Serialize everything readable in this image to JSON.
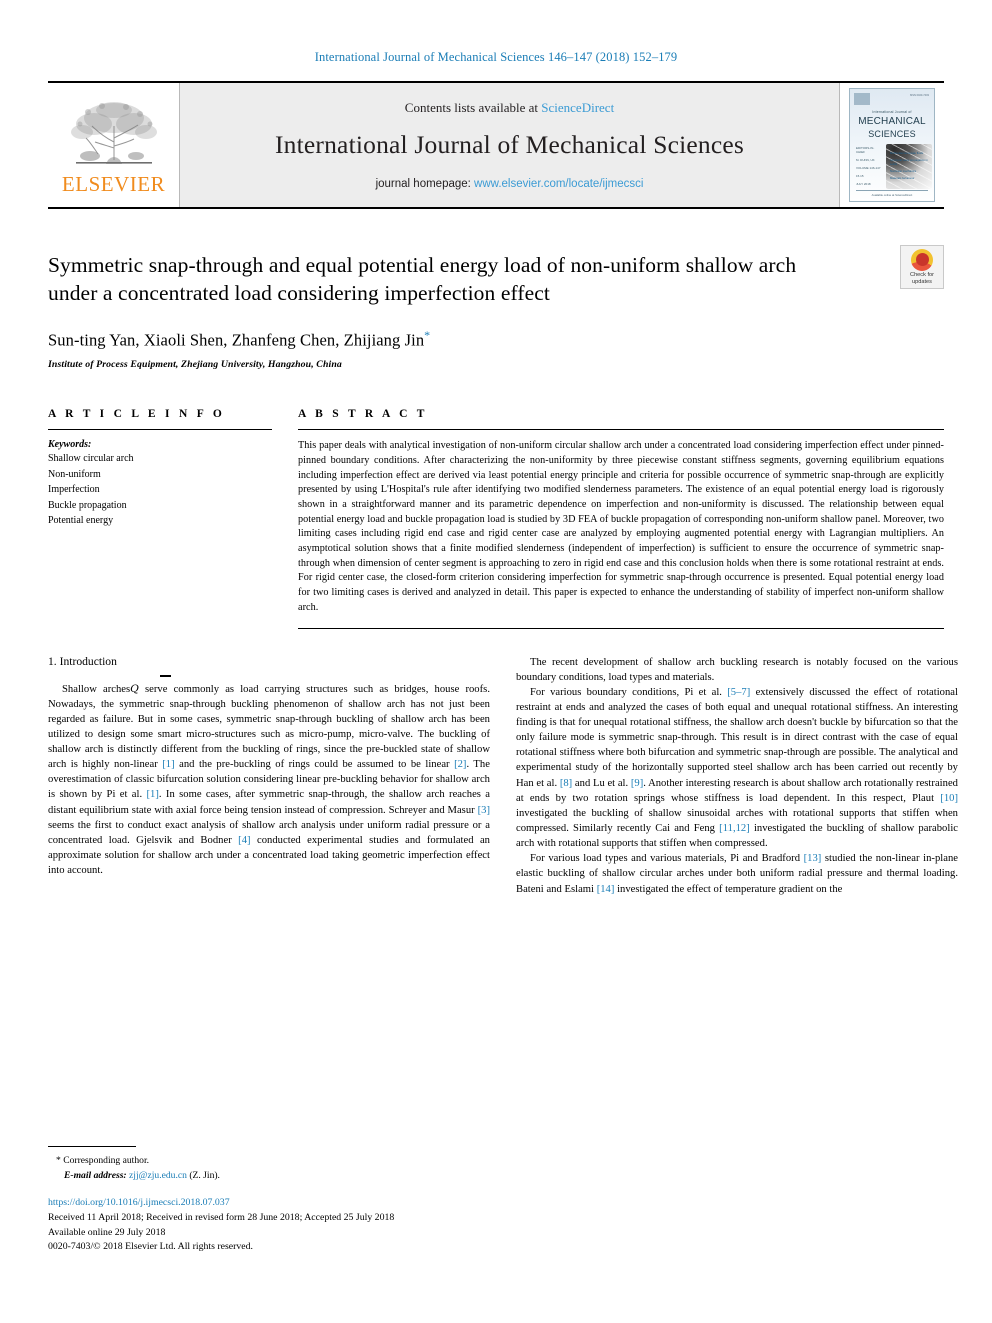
{
  "running_head": "International Journal of Mechanical Sciences 146–147 (2018) 152–179",
  "masthead": {
    "publisher": "ELSEVIER",
    "contents_prefix": "Contents lists available at ",
    "contents_link": "ScienceDirect",
    "journal_title": "International Journal of Mechanical Sciences",
    "homepage_prefix": "journal homepage: ",
    "homepage_url": "www.elsevier.com/locate/ijmecsci",
    "cover": {
      "issn": "ISSN 0020-7403",
      "subtitle": "International Journal of",
      "line1": "MECHANICAL",
      "line2": "SCIENCES",
      "left_items": [
        "EDITORS-IN-CHIEF",
        "M. DUNN, UK",
        "J.R. BARBER",
        "VOLUME 146-147",
        "ISSUE",
        "15.15",
        "JULY 2018"
      ],
      "right_items": [
        "Multiscale/nanoscale fluids",
        "Structural wave propagation in solids",
        "Nonlinear mechanics",
        "Materials behaviour"
      ],
      "footer": "Available online at ScienceDirect"
    }
  },
  "article": {
    "title": "Symmetric snap-through and equal potential energy load of non-uniform shallow arch under a concentrated load considering imperfection effect",
    "authors": "Sun-ting Yan, Xiaoli Shen, Zhanfeng Chen, Zhijiang Jin",
    "corresponding_marker": "*",
    "affiliation": "Institute of Process Equipment, Zhejiang University, Hangzhou, China",
    "crossmark": "Check for updates"
  },
  "article_info": {
    "heading": "A R T I C L E   I N F O",
    "keywords_label": "Keywords:",
    "keywords": [
      "Shallow circular arch",
      "Non-uniform",
      "Imperfection",
      "Buckle propagation",
      "Potential energy"
    ]
  },
  "abstract": {
    "heading": "A B S T R A C T",
    "text": "This paper deals with analytical investigation of non-uniform circular shallow arch under a concentrated load considering imperfection effect under pinned-pinned boundary conditions. After characterizing the non-uniformity by three piecewise constant stiffness segments, governing equilibrium equations including imperfection effect are derived via least potential energy principle and criteria for possible occurrence of symmetric snap-through are explicitly presented by using L'Hospital's rule after identifying two modified slenderness parameters. The existence of an equal potential energy load is rigorously shown in a straightforward manner and its parametric dependence on imperfection and non-uniformity is discussed. The relationship between equal potential energy load and buckle propagation load is studied by 3D FEA of buckle propagation of corresponding non-uniform shallow panel. Moreover, two limiting cases including rigid end case and rigid center case are analyzed by employing augmented potential energy with Lagrangian multipliers. An asymptotical solution shows that a finite modified slenderness (independent of imperfection) is sufficient to ensure the occurrence of symmetric snap-through when dimension of center segment is approaching to zero in rigid end case and this conclusion holds when there is some rotational restraint at ends. For rigid center case, the closed-form criterion considering imperfection for symmetric snap-through occurrence is presented. Equal potential energy load for two limiting cases is derived and analyzed in detail. This paper is expected to enhance the understanding of stability of imperfect non-uniform shallow arch."
  },
  "body": {
    "section_heading": "1. Introduction",
    "left_paragraphs": [
      "Shallow arches𝑄 serve commonly as load carrying structures such as bridges, house roofs. Nowadays, the symmetric snap-through buckling phenomenon of shallow arch has not just been regarded as failure. But in some cases, symmetric snap-through buckling of shallow arch has been utilized to design some smart micro-structures such as micro-pump, micro-valve. The buckling of shallow arch is distinctly different from the buckling of rings, since the pre-buckled state of shallow arch is highly non-linear [1] and the pre-buckling of rings could be assumed to be linear [2]. The overestimation of classic bifurcation solution considering linear pre-buckling behavior for shallow arch is shown by Pi et al. [1]. In some cases, after symmetric snap-through, the shallow arch reaches a distant equilibrium state with axial force being tension instead of compression. Schreyer and Masur [3] seems the first to conduct exact analysis of shallow arch analysis under uniform radial pressure or a concentrated load. Gjelsvik and Bodner [4] conducted experimental studies and formulated an approximate solution for shallow arch under a concentrated load taking geometric imperfection effect into account."
    ],
    "right_paragraphs": [
      "The recent development of shallow arch buckling research is notably focused on the various boundary conditions, load types and materials.",
      "For various boundary conditions, Pi et al. [5–7] extensively discussed the effect of rotational restraint at ends and analyzed the cases of both equal and unequal rotational stiffness. An interesting finding is that for unequal rotational stiffness, the shallow arch doesn't buckle by bifurcation so that the only failure mode is symmetric snap-through. This result is in direct contrast with the case of equal rotational stiffness where both bifurcation and symmetric snap-through are possible. The analytical and experimental study of the horizontally supported steel shallow arch has been carried out recently by Han et al. [8] and Lu et al. [9]. Another interesting research is about shallow arch rotationally restrained at ends by two rotation springs whose stiffness is load dependent. In this respect, Plaut [10] investigated the buckling of shallow sinusoidal arches with rotational supports that stiffen when compressed. Similarly recently Cai and Feng [11,12] investigated the buckling of shallow parabolic arch with rotational supports that stiffen when compressed.",
      "For various load types and various materials, Pi and Bradford [13] studied the non-linear in-plane elastic buckling of shallow circular arches under both uniform radial pressure and thermal loading. Bateni and Eslami [14] investigated the effect of temperature gradient on the"
    ]
  },
  "footer": {
    "corresponding_star": "*",
    "corresponding_text": "Corresponding author.",
    "email_label": "E-mail address:",
    "email": "zjj@zju.edu.cn",
    "email_person": "(Z. Jin).",
    "doi": "https://doi.org/10.1016/j.ijmecsci.2018.07.037",
    "history": "Received 11 April 2018; Received in revised form 28 June 2018; Accepted 25 July 2018",
    "available": "Available online 29 July 2018",
    "copyright": "0020-7403/© 2018 Elsevier Ltd. All rights reserved."
  },
  "colors": {
    "link": "#1a7db6",
    "elsevier_orange": "#f08b1d",
    "sciencedirect_blue": "#3b9bd4"
  }
}
